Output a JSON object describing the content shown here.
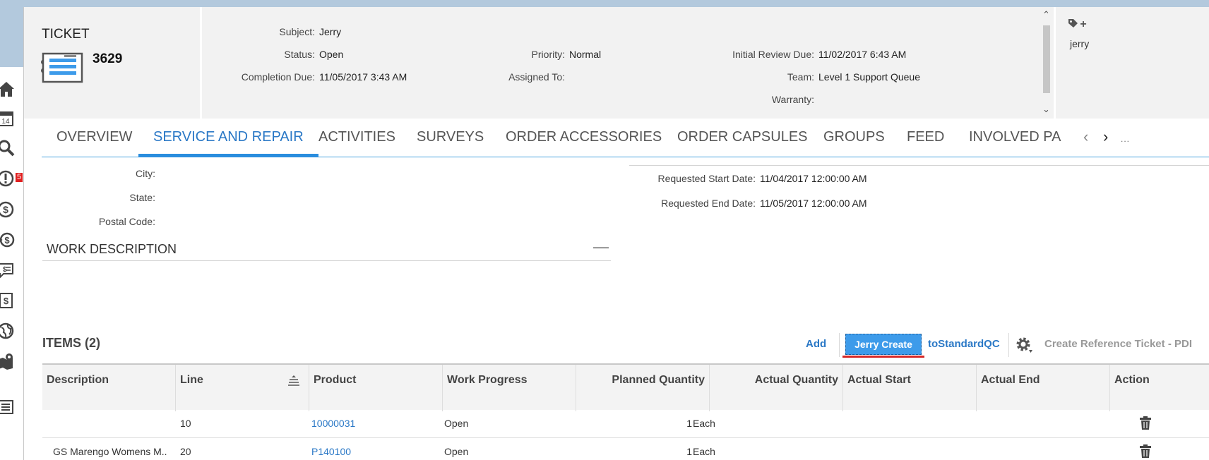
{
  "colors": {
    "accent": "#2a8dde",
    "link": "#2a78c6",
    "primary_button": "#3d9bea",
    "badge": "#e02020",
    "header_bg": "#f2f2f2"
  },
  "sidebar": {
    "icons": [
      "home-icon",
      "calendar-icon",
      "search-icon",
      "alert-icon",
      "dollar-icon",
      "exchange-dollar-icon",
      "chat-dollar-icon",
      "document-dollar-icon",
      "globe-icon",
      "map-pin-icon",
      "list-icon"
    ],
    "calendar_day": "14",
    "alert_badge": "5"
  },
  "ticket": {
    "label": "TICKET",
    "number": "3629",
    "fields": {
      "subject_label": "Subject:",
      "subject_value": "Jerry",
      "status_label": "Status:",
      "status_value": "Open",
      "completion_label": "Completion Due:",
      "completion_value": "11/05/2017 3:43 AM",
      "priority_label": "Priority:",
      "priority_value": "Normal",
      "assigned_label": "Assigned To:",
      "assigned_value": "",
      "review_label": "Initial Review Due:",
      "review_value": "11/02/2017 6:43 AM",
      "team_label": "Team:",
      "team_value": "Level 1 Support Queue",
      "warranty_label": "Warranty:",
      "warranty_value": ""
    },
    "tag": "jerry",
    "tag_plus": "+"
  },
  "tabs": {
    "items": [
      "OVERVIEW",
      "SERVICE AND REPAIR",
      "ACTIVITIES",
      "SURVEYS",
      "ORDER ACCESSORIES",
      "ORDER CAPSULES",
      "GROUPS",
      "FEED",
      "INVOLVED PA"
    ],
    "active": "SERVICE AND REPAIR",
    "prev": "‹",
    "next": "›",
    "more": "..."
  },
  "service": {
    "city_label": "City:",
    "city_value": "",
    "state_label": "State:",
    "state_value": "",
    "postal_label": "Postal Code:",
    "postal_value": "",
    "req_start_label": "Requested Start Date:",
    "req_start_value": "11/04/2017 12:00:00 AM",
    "req_end_label": "Requested End Date:",
    "req_end_value": "11/05/2017 12:00:00 AM",
    "work_description_title": "WORK DESCRIPTION",
    "collapse_symbol": "—"
  },
  "items": {
    "title": "ITEMS (2)",
    "toolbar": {
      "add": "Add",
      "jerry_create": "Jerry Create",
      "to_standard_qc": "toStandardQC",
      "create_reference": "Create Reference Ticket - PDI"
    },
    "columns": [
      "Description",
      "Line",
      "Product",
      "Work Progress",
      "Planned Quantity",
      "Actual Quantity",
      "Actual Start",
      "Actual End",
      "Action"
    ],
    "rows": [
      {
        "description": "",
        "line": "10",
        "product": "10000031",
        "work_progress": "Open",
        "planned_quantity": "1",
        "planned_unit": "Each",
        "actual_quantity": "",
        "actual_start": "",
        "actual_end": ""
      },
      {
        "description": "GS Marengo Womens M..",
        "line": "20",
        "product": "P140100",
        "work_progress": "Open",
        "planned_quantity": "1",
        "planned_unit": "Each",
        "actual_quantity": "",
        "actual_start": "",
        "actual_end": ""
      }
    ]
  }
}
